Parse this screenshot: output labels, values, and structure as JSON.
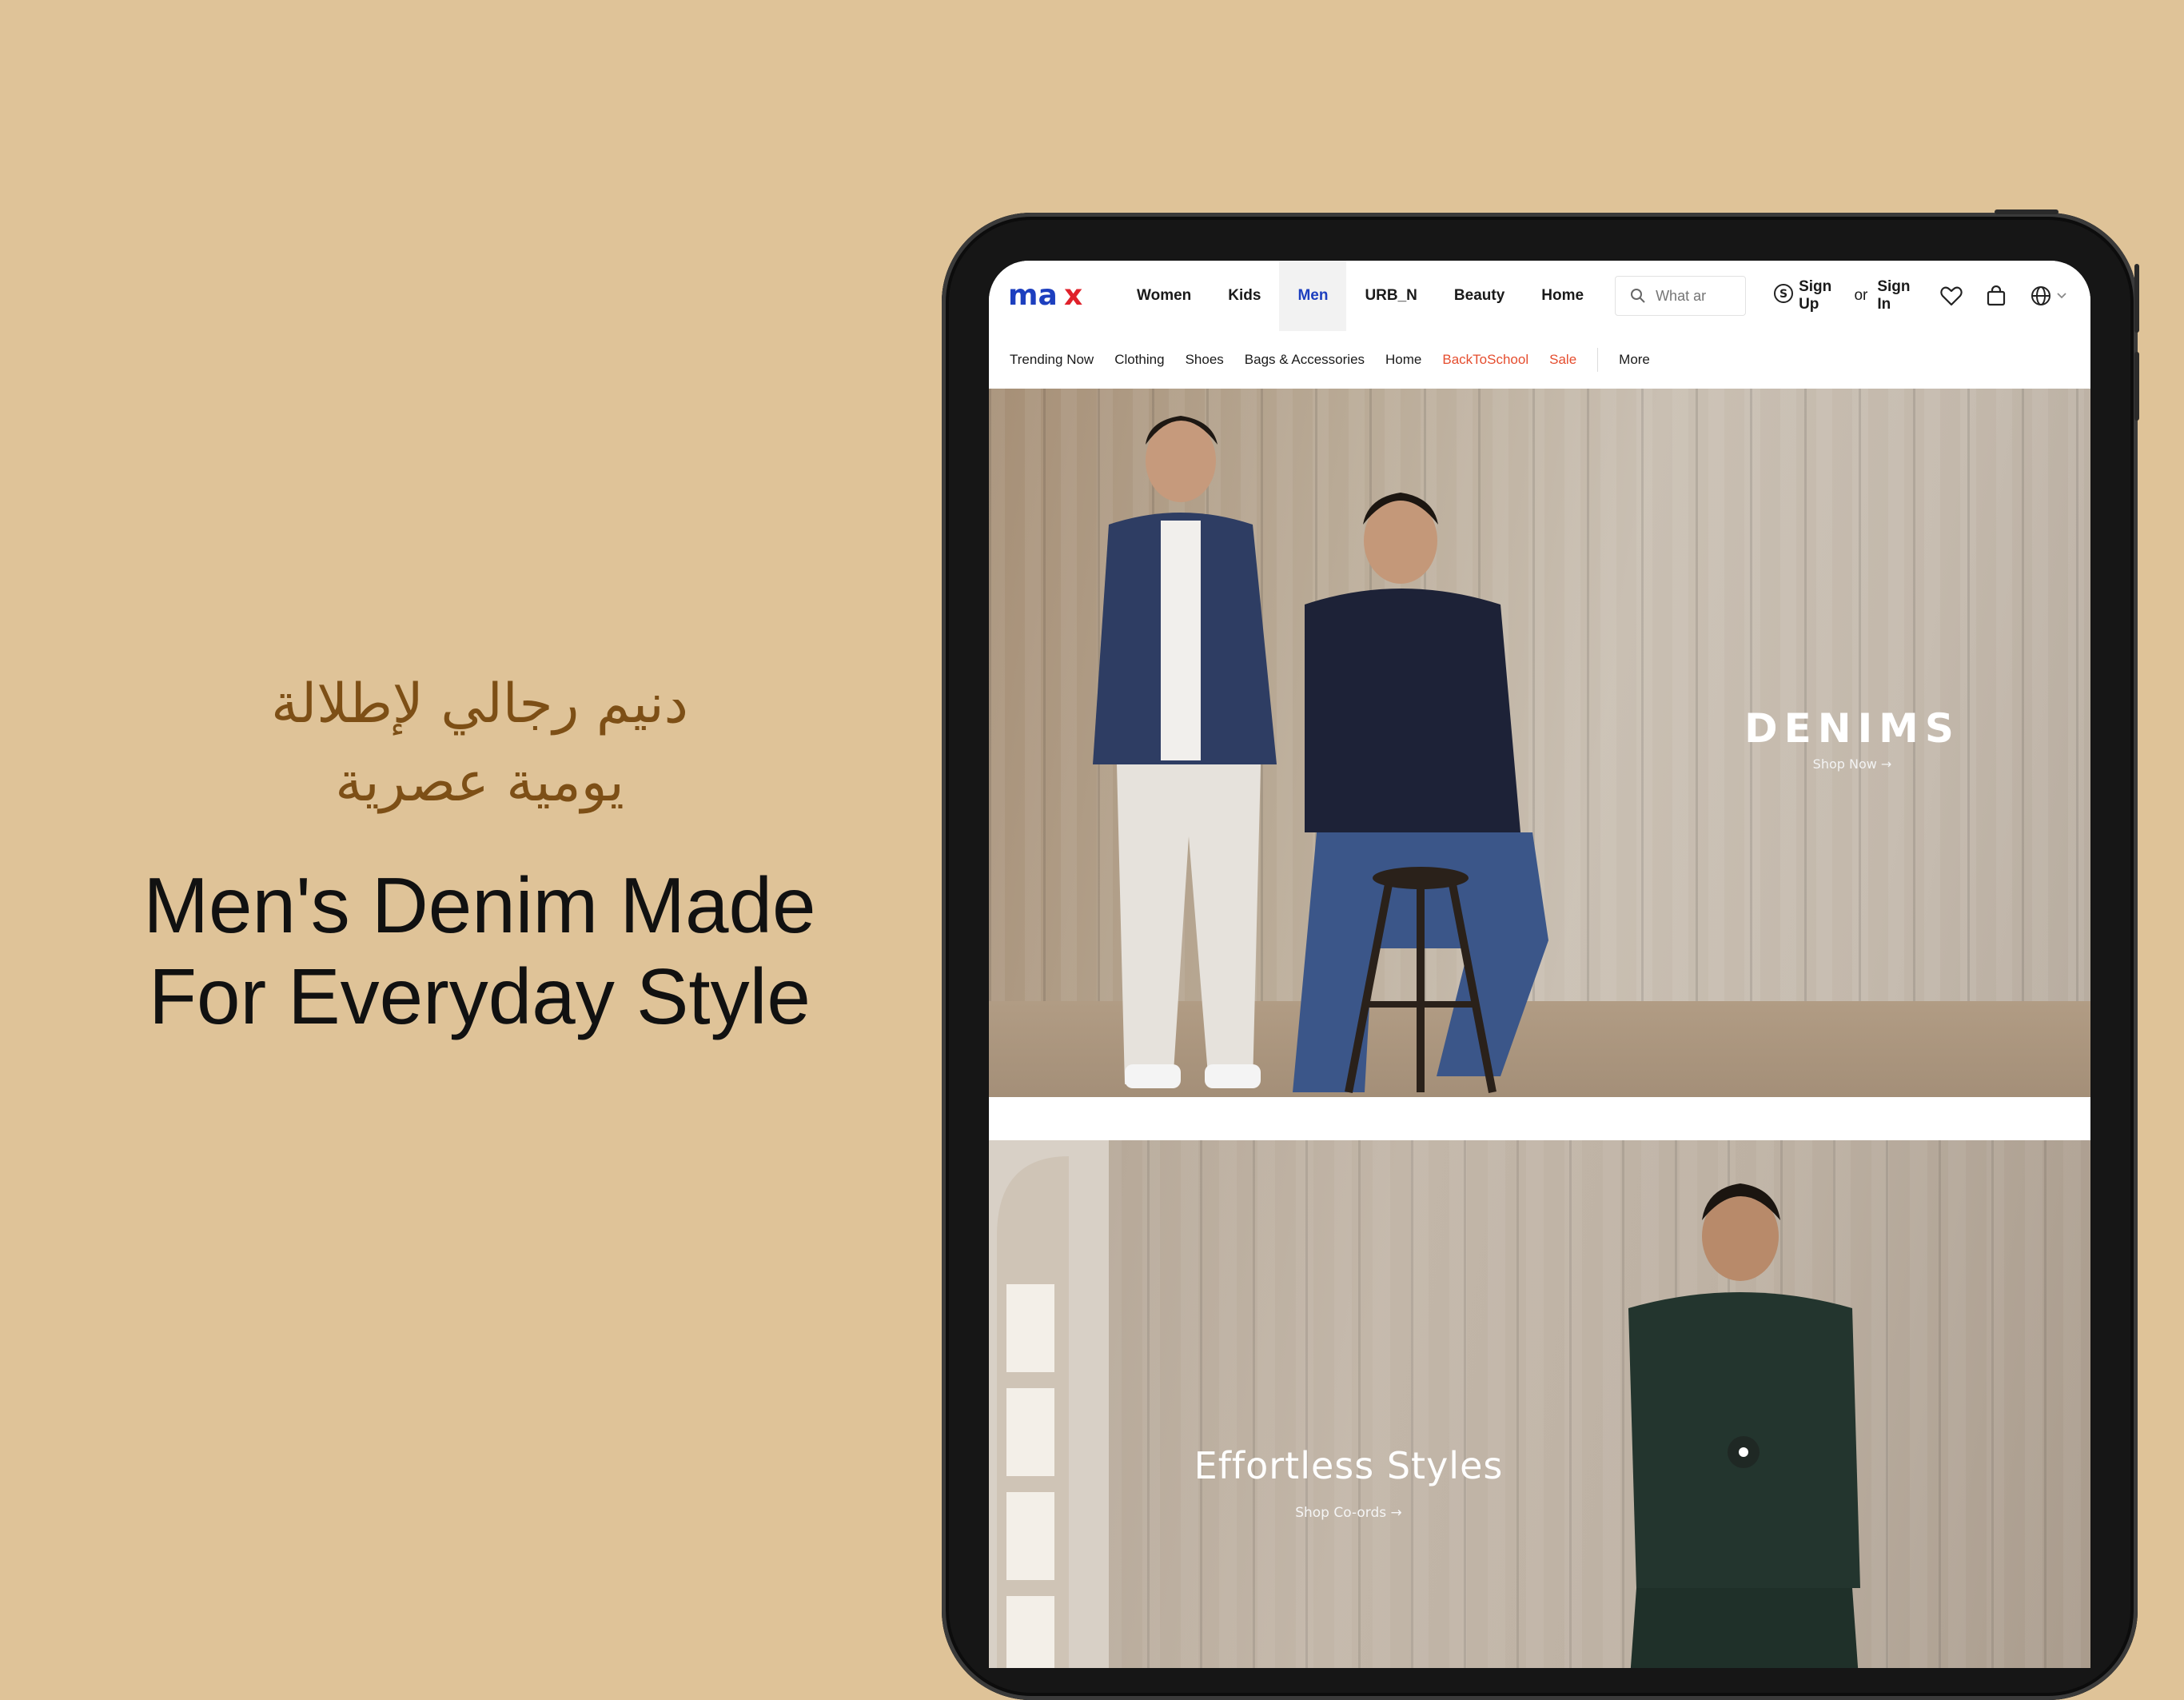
{
  "promo": {
    "arabic_line1": "دنيم رجالي لإطلالة",
    "arabic_line2": "يومية  عصرية",
    "english_line1": "Men's Denim Made",
    "english_line2": "For Everyday Style"
  },
  "colors": {
    "background": "#dfc398",
    "arabic_text": "#7d4f16",
    "brand_blue": "#1d3fbf",
    "brand_red": "#e0212b",
    "highlight": "#e54d2e"
  },
  "header": {
    "logo_text": "max",
    "nav": [
      {
        "label": "Women",
        "active": false
      },
      {
        "label": "Kids",
        "active": false
      },
      {
        "label": "Men",
        "active": true
      },
      {
        "label": "URB_N",
        "active": false
      },
      {
        "label": "Beauty",
        "active": false
      },
      {
        "label": "Home",
        "active": false
      }
    ],
    "search_placeholder": "What ar",
    "sign_up": "Sign Up",
    "or": "or",
    "sign_in": "Sign In",
    "icons": [
      "coin-icon",
      "heart-icon",
      "bag-icon",
      "globe-icon",
      "chevron-down-icon"
    ]
  },
  "subnav": [
    {
      "label": "Trending Now",
      "highlight": false
    },
    {
      "label": "Clothing",
      "highlight": false
    },
    {
      "label": "Shoes",
      "highlight": false
    },
    {
      "label": "Bags & Accessories",
      "highlight": false
    },
    {
      "label": "Home",
      "highlight": false
    },
    {
      "label": "BackToSchool",
      "highlight": true
    },
    {
      "label": "Sale",
      "highlight": true
    },
    {
      "label": "More",
      "highlight": false
    }
  ],
  "banners": [
    {
      "title": "DENIMS",
      "cta": "Shop Now →"
    },
    {
      "title": "Effortless Styles",
      "cta": "Shop Co-ords →"
    }
  ]
}
